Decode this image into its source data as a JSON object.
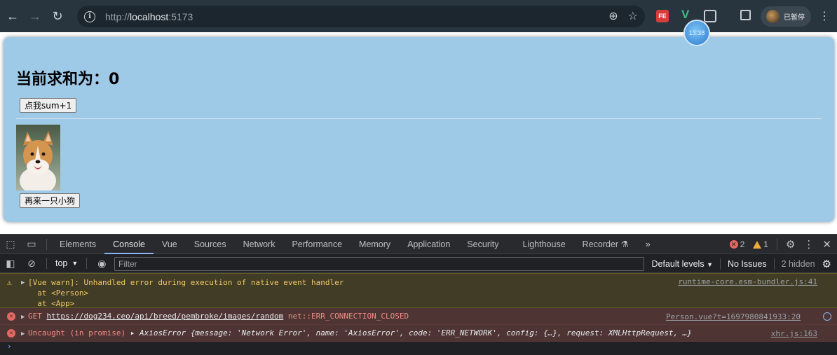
{
  "browser": {
    "url_prefix": "http://",
    "url_host": "localhost",
    "url_port": ":5173",
    "ext_fe": "FE",
    "ext_v": "V",
    "profile_label": "已暂停",
    "clock": "13:38"
  },
  "page": {
    "sum_heading": "当前求和为：0",
    "sum_button": "点我sum+1",
    "dog_button": "再来一只小狗",
    "dog_image_icon": "corgi-dog-photo"
  },
  "devtools": {
    "tabs": [
      "Elements",
      "Console",
      "Vue",
      "Sources",
      "Network",
      "Performance",
      "Memory",
      "Application",
      "Security",
      "Lighthouse",
      "Recorder"
    ],
    "active_tab": "Console",
    "error_count": "2",
    "warning_count": "1",
    "context": "top",
    "filter_placeholder": "Filter",
    "levels": "Default levels",
    "issues": "No Issues",
    "hidden": "2 hidden",
    "logs": {
      "warn_line1": "[Vue warn]: Unhandled error during execution of native event handler",
      "warn_line2": "  at <Person>",
      "warn_line3": "  at <App>",
      "warn_src": "runtime-core.esm-bundler.js:41",
      "get_prefix": "GET ",
      "get_url": "https://dog234.ceo/api/breed/pembroke/images/random",
      "get_err": " net::ERR_CONNECTION_CLOSED",
      "get_src": "Person.vue?t=1697980841933:20",
      "uncaught": "Uncaught (in promise) ",
      "axios_name": "AxiosError ",
      "axios_body": "{message: 'Network Error', name: 'AxiosError', code: 'ERR_NETWORK', config: {…}, request: XMLHttpRequest, …}",
      "axios_src": "xhr.js:163"
    }
  },
  "colors": {
    "app_bg": "#9ecae8",
    "warn_bg": "#413c26",
    "error_bg": "#4e3534",
    "accent": "#8ab4f8"
  }
}
